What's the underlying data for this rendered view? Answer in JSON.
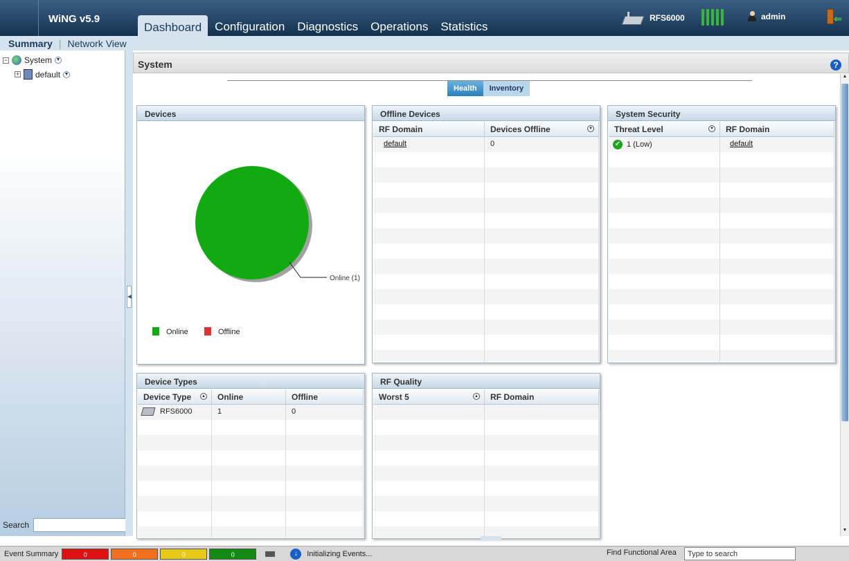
{
  "app": {
    "title": "WiNG v5.9"
  },
  "nav": {
    "tabs": [
      "Dashboard",
      "Configuration",
      "Diagnostics",
      "Operations",
      "Statistics"
    ],
    "active": "Dashboard"
  },
  "device": {
    "name": "RFS6000"
  },
  "user": {
    "name": "admin"
  },
  "subnav": {
    "summary": "Summary",
    "network_view": "Network View"
  },
  "tree": {
    "root": "System",
    "child": "default"
  },
  "search": {
    "label": "Search"
  },
  "main": {
    "title": "System",
    "help": "?"
  },
  "toggle": {
    "health": "Health",
    "inventory": "Inventory"
  },
  "devices": {
    "title": "Devices",
    "legend": {
      "online": "Online",
      "offline": "Offline"
    },
    "online_color": "#11aa11",
    "offline_color": "#dd3333"
  },
  "chart_data": {
    "type": "pie",
    "slices": [
      {
        "label": "Online (1)",
        "value": 1,
        "color": "#11aa11"
      }
    ],
    "legend": [
      "Online",
      "Offline"
    ]
  },
  "offline_devices": {
    "title": "Offline Devices",
    "columns": [
      "RF Domain",
      "Devices Offline"
    ],
    "rows": [
      [
        "default",
        "0"
      ]
    ]
  },
  "system_security": {
    "title": "System Security",
    "columns": [
      "Threat Level",
      "RF Domain"
    ],
    "rows": [
      [
        "1 (Low)",
        "default"
      ]
    ]
  },
  "device_types": {
    "title": "Device Types",
    "columns": [
      "Device Type",
      "Online",
      "Offline"
    ],
    "rows": [
      [
        "RFS6000",
        "1",
        "0"
      ]
    ]
  },
  "rf_quality": {
    "title": "RF Quality",
    "columns": [
      "Worst 5",
      "RF Domain"
    ]
  },
  "status": {
    "event_summary": "Event Summary",
    "counts": [
      "0",
      "0",
      "0",
      "0"
    ],
    "colors": [
      "#dd1111",
      "#f07020",
      "#e8c81a",
      "#138a13"
    ],
    "message": "Initializing Events...",
    "find_label": "Find Functional Area",
    "find_placeholder": "Type to search"
  }
}
